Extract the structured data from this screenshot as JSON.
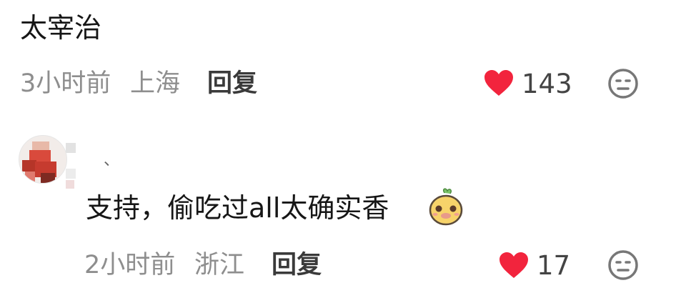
{
  "comments": [
    {
      "text": "太宰治",
      "time": "3小时前",
      "location": "上海",
      "reply_label": "回复",
      "likes": "143"
    },
    {
      "username": "、",
      "text": "支持，偷吃过all太确实香",
      "time": "2小时前",
      "location": "浙江",
      "reply_label": "回复",
      "likes": "17"
    }
  ],
  "icons": {
    "like": "heart-icon",
    "dislike": "neutral-face-icon",
    "emoji": "sticker-emoji-icon"
  },
  "colors": {
    "like": "#f2243d",
    "meta_text": "#8e8e8e",
    "main_text": "#161616",
    "icon_gray": "#777777"
  }
}
